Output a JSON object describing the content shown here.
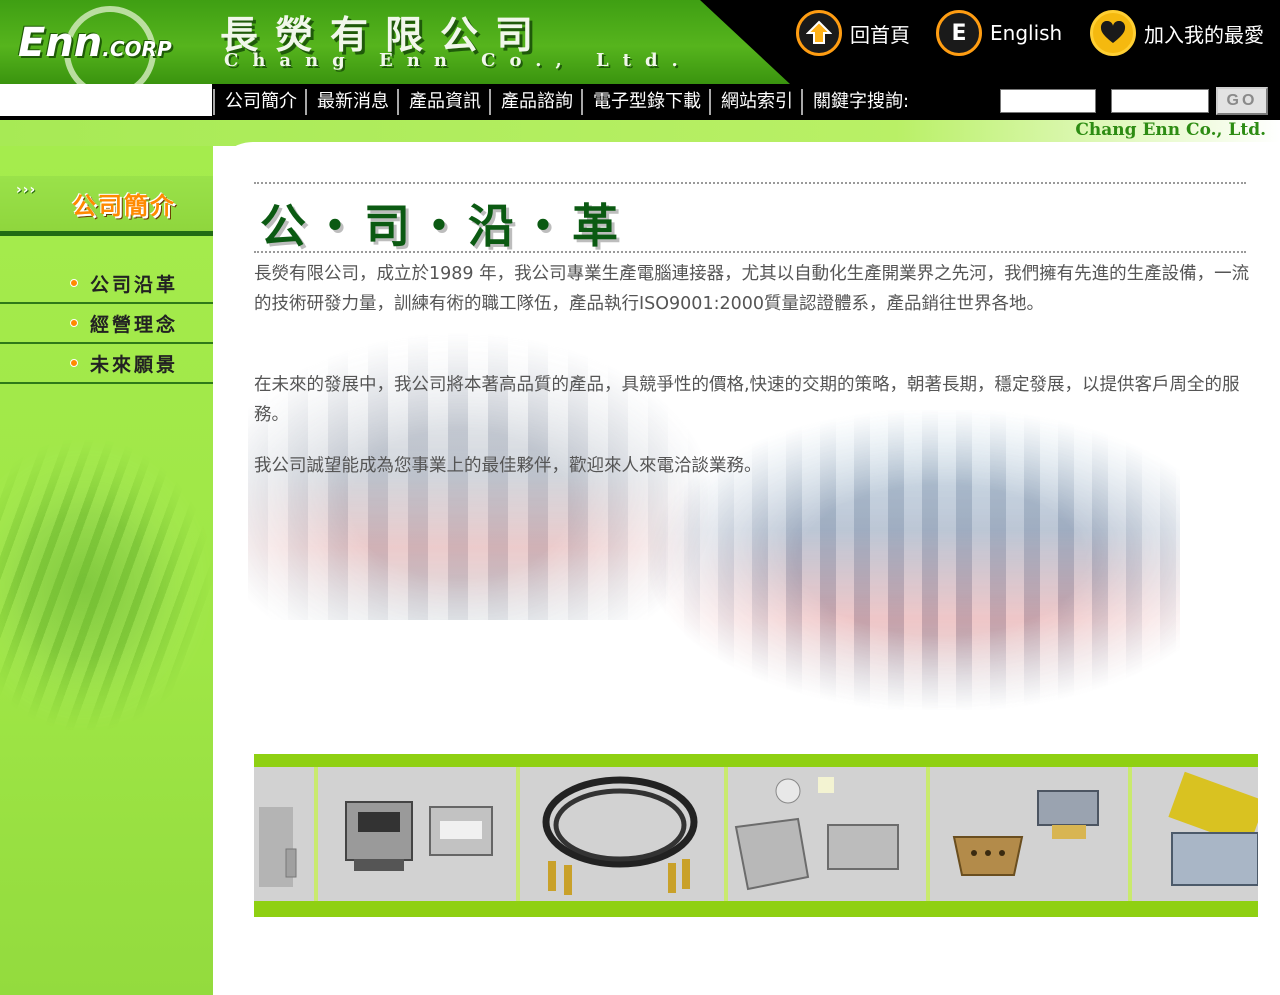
{
  "header": {
    "logo_big": "Enn",
    "logo_small": ".CORP",
    "company_cn": "長熒有限公司",
    "company_en": "Chang Enn Co., Ltd.",
    "links": {
      "home": "回首頁",
      "english_icon_letter": "E",
      "english": "English",
      "favorite": "加入我的最愛"
    },
    "icons": {
      "home": "home-arrow-icon",
      "english": "letter-e-icon",
      "favorite": "heart-icon"
    }
  },
  "nav": {
    "items": [
      "公司簡介",
      "最新消息",
      "產品資訊",
      "產品諮詢",
      "電子型錄下載",
      "網站索引"
    ],
    "search_label": "關鍵字搜詢:",
    "search_value1": "",
    "search_value2": "",
    "go_label": "GO"
  },
  "tagline": "Chang Enn Co., Ltd.",
  "sidebar": {
    "arrows": "›››",
    "title": "公司簡介",
    "items": [
      "公司沿革",
      "經營理念",
      "未來願景"
    ]
  },
  "main": {
    "heading": "公・司・沿・革",
    "paragraphs": [
      "長熒有限公司，成立於1989 年，我公司專業生產電腦連接器，尤其以自動化生產開業界之先河，我們擁有先進的生產設備，一流的技術研發力量，訓練有術的職工隊伍，產品執行ISO9001:2000質量認證體系，產品銷往世界各地。",
      "在未來的發展中，我公司將本著高品質的產品，具競爭性的價格,快速的交期的策略，朝著長期，穩定發展，以提供客戶周全的服務。",
      "我公司誠望能成為您事業上的最佳夥伴，歡迎來人來電洽談業務。"
    ]
  },
  "products": [
    "metal-bracket",
    "usb-connector",
    "rca-cable",
    "d-sub-hood",
    "d-sub-connector",
    "gender-changer"
  ],
  "colors": {
    "brand_green": "#56b41d",
    "sidebar_green": "#a5ec4d",
    "accent_orange": "#ff8a00",
    "heading_green": "#0b5a12"
  }
}
